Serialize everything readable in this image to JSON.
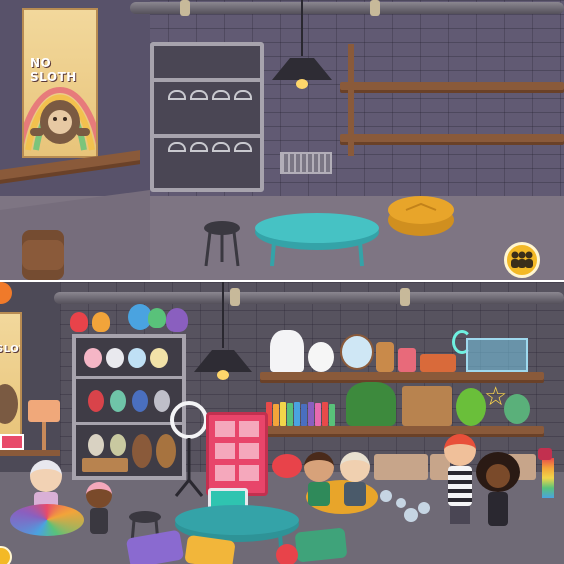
{
  "top_scene": {
    "poster_text": "NO SLOTH"
  },
  "bottom_scene": {
    "poster_text": "SLOTH"
  },
  "colors": {
    "wall": "#5d5670",
    "floor": "#7e7583",
    "shelf_wood": "#8a5a3a",
    "table_teal": "#34a3a8",
    "pouf_orange": "#e8a52a",
    "locker_pink": "#e8456a"
  },
  "icons": {
    "people_button": "group-of-people-icon",
    "orange_corner": "orange-circle-icon"
  }
}
